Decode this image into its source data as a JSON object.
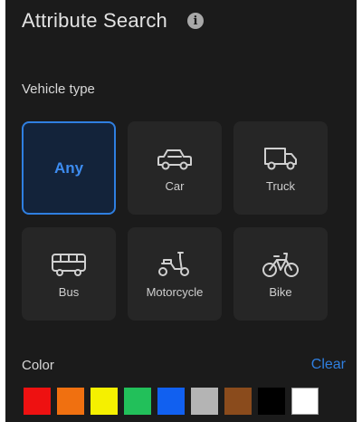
{
  "header": {
    "title": "Attribute Search",
    "info_icon": "info-icon"
  },
  "vehicle_type": {
    "label": "Vehicle type",
    "selected": "Any",
    "options": [
      {
        "label": "Any",
        "icon": ""
      },
      {
        "label": "Car",
        "icon": "car-icon"
      },
      {
        "label": "Truck",
        "icon": "truck-icon"
      },
      {
        "label": "Bus",
        "icon": "bus-icon"
      },
      {
        "label": "Motorcycle",
        "icon": "motorcycle-icon"
      },
      {
        "label": "Bike",
        "icon": "bike-icon"
      }
    ]
  },
  "color": {
    "label": "Color",
    "clear_label": "Clear",
    "swatches": [
      {
        "name": "red",
        "hex": "#ee1111"
      },
      {
        "name": "orange",
        "hex": "#f07010"
      },
      {
        "name": "yellow",
        "hex": "#f5f000"
      },
      {
        "name": "green",
        "hex": "#22c05a"
      },
      {
        "name": "blue",
        "hex": "#1160f0"
      },
      {
        "name": "gray",
        "hex": "#b4b4b4"
      },
      {
        "name": "brown",
        "hex": "#8a4b1c"
      },
      {
        "name": "black",
        "hex": "#000000"
      },
      {
        "name": "white",
        "hex": "#ffffff"
      }
    ]
  },
  "colors": {
    "accent": "#2f7fe0",
    "panel_bg": "#1b1b1b",
    "tile_bg": "#262626"
  }
}
